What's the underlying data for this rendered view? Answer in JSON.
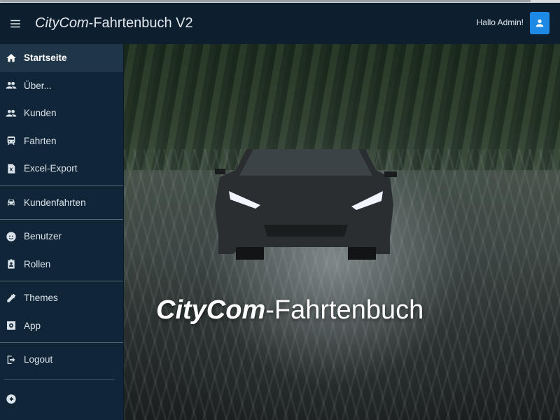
{
  "header": {
    "title_italic": "CityCom",
    "title_rest": "-Fahrtenbuch V2",
    "greeting": "Hallo Admin!",
    "menu_icon": "hamburger-icon",
    "avatar_icon": "person-icon"
  },
  "sidebar": {
    "items": [
      {
        "label": "Startseite",
        "icon": "home-icon",
        "active": true
      },
      {
        "label": "Über...",
        "icon": "people-icon"
      },
      {
        "label": "Kunden",
        "icon": "people-icon"
      },
      {
        "label": "Fahrten",
        "icon": "train-icon"
      },
      {
        "label": "Excel-Export",
        "icon": "excel-icon"
      },
      {
        "label": "Kundenfahrten",
        "icon": "car-icon"
      },
      {
        "label": "Benutzer",
        "icon": "face-icon"
      },
      {
        "label": "Rollen",
        "icon": "badge-icon"
      },
      {
        "label": "Themes",
        "icon": "eyedropper-icon"
      },
      {
        "label": "App",
        "icon": "settings-box-icon"
      },
      {
        "label": "Logout",
        "icon": "logout-icon"
      }
    ],
    "collapse_icon": "arrow-left-circle-icon"
  },
  "hero": {
    "title_italic": "CityCom",
    "title_rest": "-Fahrtenbuch"
  },
  "colors": {
    "appbar": "#0d1f2f",
    "sidebar": "#102537",
    "active_item": "#1f3648",
    "avatar": "#1e88e5"
  }
}
